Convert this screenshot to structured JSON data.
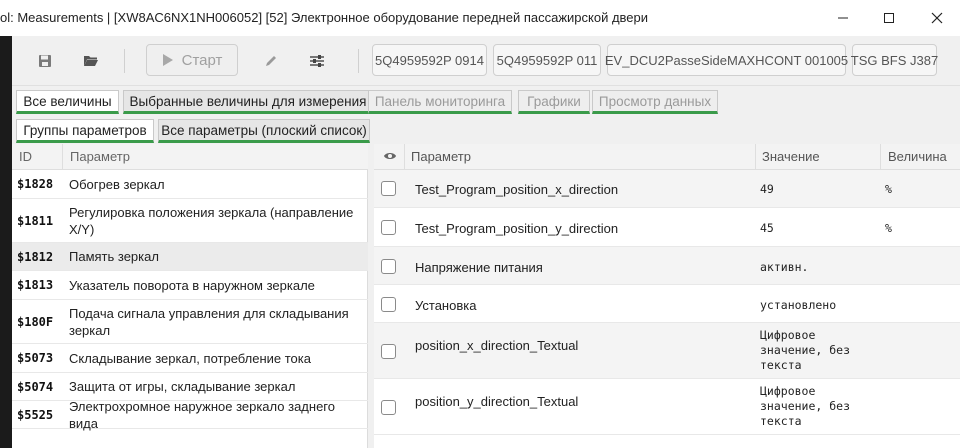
{
  "window": {
    "title": "ol: Measurements | [XW8AC6NX1NH006052] [52] Электронное оборудование передней пассажирской двери",
    "controls": [
      "minimize-icon",
      "maximize-icon",
      "close-icon"
    ]
  },
  "toolbar": {
    "icons": [
      "save-icon",
      "open-folder-icon",
      "pencil-icon",
      "sliders-icon"
    ],
    "start_label": "Старт",
    "chips": [
      "5Q4959592P  0914",
      "5Q4959592P  011",
      "EV_DCU2PasseSideMAXHCONT 001005",
      "TSG BFS J387"
    ]
  },
  "tabs": [
    {
      "label": "Все величины",
      "state": "active"
    },
    {
      "label": "Выбранные величины для измерения",
      "state": "normal"
    },
    {
      "label": "Панель мониторинга",
      "state": "disabled"
    },
    {
      "label": "Графики",
      "state": "disabled"
    },
    {
      "label": "Просмотр данных",
      "state": "disabled"
    }
  ],
  "subtabs": [
    {
      "label": "Группы параметров",
      "state": "active"
    },
    {
      "label": "Все параметры (плоский список)",
      "state": "normal"
    }
  ],
  "groups": {
    "columns": {
      "id": "ID",
      "name": "Параметр"
    },
    "rows": [
      {
        "id": "$1828",
        "name": "Обогрев зеркал"
      },
      {
        "id": "$1811",
        "name": "Регулировка положения зеркала (направление X/Y)"
      },
      {
        "id": "$1812",
        "name": "Память зеркал",
        "selected": true
      },
      {
        "id": "$1813",
        "name": "Указатель поворота в наружном зеркале"
      },
      {
        "id": "$180F",
        "name": "Подача сигнала управления для складывания зеркал"
      },
      {
        "id": "$5073",
        "name": "Складывание зеркал, потребление тока"
      },
      {
        "id": "$5074",
        "name": "Защита от игры, складывание зеркал"
      },
      {
        "id": "$5525",
        "name": "Электрохромное наружное зеркало заднего вида"
      }
    ]
  },
  "params": {
    "columns": {
      "eye": "eye-icon",
      "name": "Параметр",
      "value": "Значение",
      "unit": "Величина"
    },
    "rows": [
      {
        "name": "Test_Program_position_x_direction",
        "value": "49",
        "unit": "%"
      },
      {
        "name": "Test_Program_position_y_direction",
        "value": "45",
        "unit": "%"
      },
      {
        "name": "Напряжение питания",
        "value": "активн.",
        "unit": ""
      },
      {
        "name": "Установка",
        "value": "установлено",
        "unit": ""
      },
      {
        "name": "position_x_direction_Textual",
        "value": "Цифровое значение, без текста",
        "unit": ""
      },
      {
        "name": "position_y_direction_Textual",
        "value": "Цифровое значение, без текста",
        "unit": ""
      }
    ]
  },
  "colors": {
    "tab_underline": "#3a9b4a",
    "selected_row": "#ebebeb"
  }
}
